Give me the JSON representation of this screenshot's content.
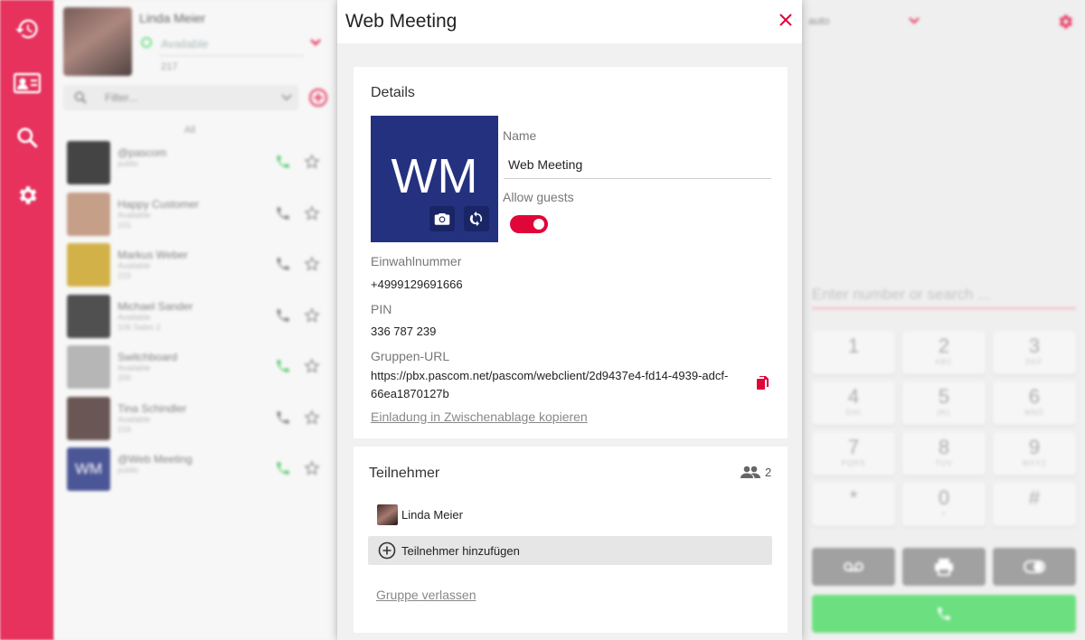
{
  "colors": {
    "accent": "#e1063a",
    "call_green": "#4cd964",
    "avatar_blue": "#24317f"
  },
  "rail": {
    "icons": [
      "history-icon",
      "contacts-icon",
      "search-icon",
      "settings-icon"
    ]
  },
  "me": {
    "name": "Linda Meier",
    "status": "Available",
    "extension": "217"
  },
  "contact_filter": {
    "placeholder": "Filter..."
  },
  "contact_list": {
    "caption": "All",
    "items": [
      {
        "name": "@pascom",
        "sub": "public",
        "sub2": "",
        "avatar": "#1b1b1b",
        "online": true
      },
      {
        "name": "Happy Customer",
        "sub": "Available",
        "sub2": "101",
        "avatar": "#b98a6e",
        "online": false
      },
      {
        "name": "Markus Weber",
        "sub": "Available",
        "sub2": "215",
        "avatar": "#c9a020",
        "online": false
      },
      {
        "name": "Michael Sander",
        "sub": "Available",
        "sub2": "106  Sales 2",
        "avatar": "#2a2a2a",
        "online": false
      },
      {
        "name": "Switchboard",
        "sub": "Available",
        "sub2": "200",
        "avatar": "#a7a7a7",
        "online": true
      },
      {
        "name": "Tina Schindler",
        "sub": "Available",
        "sub2": "216",
        "avatar": "#4a3330",
        "online": false
      },
      {
        "name": "@Web Meeting",
        "sub": "public",
        "sub2": "",
        "avatar": "#24317f",
        "online": true,
        "initials": "WM"
      }
    ]
  },
  "dialer": {
    "mode": "auto",
    "search_placeholder": "Enter number or search ...",
    "keys": [
      {
        "digit": "1",
        "letters": ""
      },
      {
        "digit": "2",
        "letters": "ABC"
      },
      {
        "digit": "3",
        "letters": "DEF"
      },
      {
        "digit": "4",
        "letters": "GHI"
      },
      {
        "digit": "5",
        "letters": "JKL"
      },
      {
        "digit": "6",
        "letters": "MNO"
      },
      {
        "digit": "7",
        "letters": "PQRS"
      },
      {
        "digit": "8",
        "letters": "TUV"
      },
      {
        "digit": "9",
        "letters": "WXYZ"
      },
      {
        "digit": "*",
        "letters": ""
      },
      {
        "digit": "0",
        "letters": "+"
      },
      {
        "digit": "#",
        "letters": ""
      }
    ]
  },
  "dialog": {
    "title": "Web Meeting",
    "details": {
      "heading": "Details",
      "avatar_initials": "WM",
      "name_label": "Name",
      "name_value": "Web Meeting",
      "allow_guests_label": "Allow guests",
      "allow_guests": true,
      "dialin_label": "Einwahlnummer",
      "dialin_value": "+4999129691666",
      "pin_label": "PIN",
      "pin_value": "336 787 239",
      "url_label": "Gruppen-URL",
      "url_value": "https://pbx.pascom.net/pascom/webclient/2d9437e4-fd14-4939-adcf-66ea1870127b",
      "copy_invite_link": "Einladung in Zwischenablage kopieren"
    },
    "members": {
      "heading": "Teilnehmer",
      "count": "2",
      "items": [
        {
          "name": "Linda Meier"
        }
      ],
      "add_label": "Teilnehmer hinzufügen",
      "leave_link": "Gruppe verlassen"
    }
  }
}
